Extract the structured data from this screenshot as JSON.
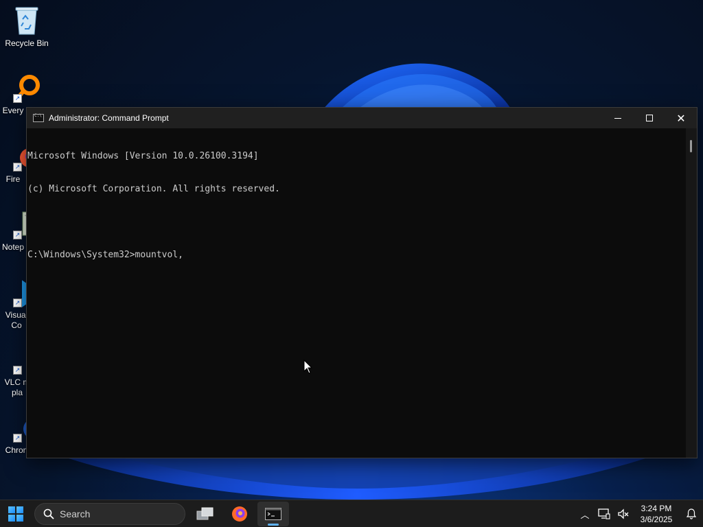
{
  "desktop": {
    "icons": [
      {
        "label": "Recycle Bin"
      },
      {
        "label": "Every"
      },
      {
        "label": "Fire"
      },
      {
        "label": "Notep"
      },
      {
        "label": "Visual\nCo"
      },
      {
        "label": "VLC m\npla"
      },
      {
        "label": "Chron"
      }
    ]
  },
  "cmd": {
    "title": "Administrator: Command Prompt",
    "lines": [
      "Microsoft Windows [Version 10.0.26100.3194]",
      "(c) Microsoft Corporation. All rights reserved.",
      "",
      "C:\\Windows\\System32>mountvol,"
    ]
  },
  "taskbar": {
    "search_placeholder": "Search",
    "clock_time": "3:24 PM",
    "clock_date": "3/6/2025"
  },
  "colors": {
    "accent": "#5fb2f2",
    "console_bg": "#0c0c0c",
    "console_fg": "#cccccc",
    "titlebar": "#202020",
    "taskbar": "#1c1c1c"
  }
}
